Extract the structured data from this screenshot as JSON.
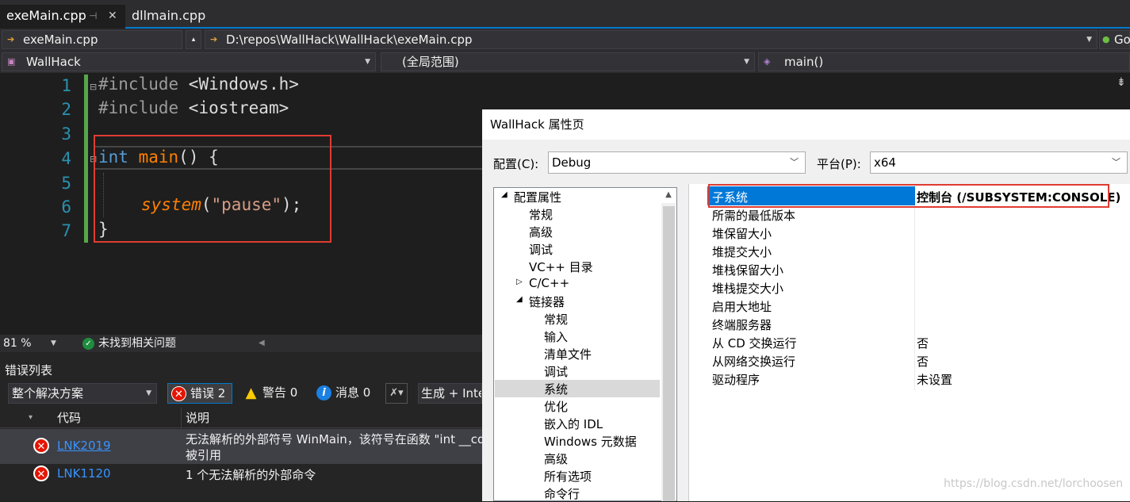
{
  "tabs": {
    "active": "exeMain.cpp",
    "other": "dllmain.cpp"
  },
  "nav": {
    "file": "exeMain.cpp",
    "path": "D:\\repos\\WallHack\\WallHack\\exeMain.cpp",
    "go": "Go",
    "project": "WallHack",
    "scope": "(全局范围)",
    "member": "main()"
  },
  "code": {
    "line_numbers": [
      "1",
      "2",
      "3",
      "4",
      "5",
      "6",
      "7"
    ],
    "line1_pp": "#include",
    "line1_rest": " <Windows.h>",
    "line2_pp": "#include",
    "line2_rest": " <iostream>",
    "line4_kw": "int",
    "line4_fn": "main",
    "line4_rest": "() {",
    "line6_fn": "system",
    "line6_open": "(",
    "line6_str": "\"pause\"",
    "line6_close": ");",
    "line7": "}"
  },
  "status": {
    "zoom": "81 %",
    "issues": "未找到相关问题"
  },
  "error_list": {
    "title": "错误列表",
    "scope": "整个解决方案",
    "errors_btn": "错误 2",
    "warnings_btn": "警告 0",
    "messages_btn": "消息 0",
    "build_filter": "生成 + Inte",
    "col_code": "代码",
    "col_desc": "说明",
    "rows": [
      {
        "code": "LNK2019",
        "desc_line1": "无法解析的外部符号 WinMain，该符号在函数 \"int __cd",
        "desc_line2": "被引用"
      },
      {
        "code": "LNK1120",
        "desc_line1": "1 个无法解析的外部命令",
        "desc_line2": ""
      }
    ]
  },
  "dialog": {
    "title": "WallHack 属性页",
    "config_label": "配置(C):",
    "config_value": "Debug",
    "platform_label": "平台(P):",
    "platform_value": "x64",
    "tree": [
      "配置属性",
      "常规",
      "高级",
      "调试",
      "VC++ 目录",
      "C/C++",
      "链接器",
      "常规",
      "输入",
      "清单文件",
      "调试",
      "系统",
      "优化",
      "嵌入的 IDL",
      "Windows 元数据",
      "高级",
      "所有选项",
      "命令行"
    ],
    "props": [
      {
        "key": "子系统",
        "value": "控制台 (/SUBSYSTEM:CONSOLE)"
      },
      {
        "key": "所需的最低版本",
        "value": ""
      },
      {
        "key": "堆保留大小",
        "value": ""
      },
      {
        "key": "堆提交大小",
        "value": ""
      },
      {
        "key": "堆栈保留大小",
        "value": ""
      },
      {
        "key": "堆栈提交大小",
        "value": ""
      },
      {
        "key": "启用大地址",
        "value": ""
      },
      {
        "key": "终端服务器",
        "value": ""
      },
      {
        "key": "从 CD 交换运行",
        "value": "否"
      },
      {
        "key": "从网络交换运行",
        "value": "否"
      },
      {
        "key": "驱动程序",
        "value": "未设置"
      }
    ]
  },
  "watermark": "https://blog.csdn.net/lorchoosen"
}
